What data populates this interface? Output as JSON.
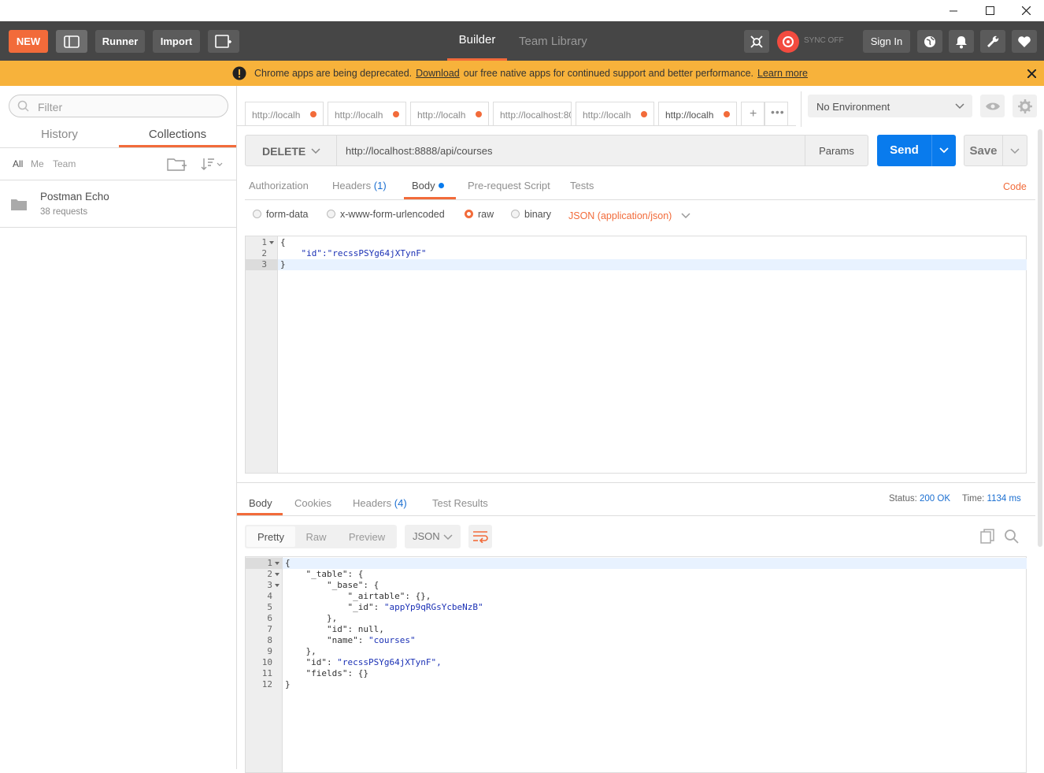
{
  "toolbar": {
    "new_label": "NEW",
    "runner_label": "Runner",
    "import_label": "Import",
    "builder_label": "Builder",
    "team_library_label": "Team Library",
    "sync_label": "SYNC OFF",
    "sign_in_label": "Sign In"
  },
  "banner": {
    "text_before": "Chrome apps are being deprecated.",
    "download_link": "Download",
    "text_after": "our free native apps for continued support and better performance.",
    "learn_more_link": "Learn more"
  },
  "sidebar": {
    "filter_placeholder": "Filter",
    "tab_history": "History",
    "tab_collections": "Collections",
    "filter_all": "All",
    "filter_me": "Me",
    "filter_team": "Team",
    "collections": [
      {
        "name": "Postman Echo",
        "count": "38 requests"
      }
    ]
  },
  "request_tabs": [
    "http://localh",
    "http://localh",
    "http://localh",
    "http://localhost:80",
    "http://localh",
    "http://localh"
  ],
  "environment": {
    "selected": "No Environment"
  },
  "request": {
    "method": "DELETE",
    "url": "http://localhost:8888/api/courses",
    "params_label": "Params",
    "send_label": "Send",
    "save_label": "Save"
  },
  "request_subtabs": {
    "authorization": "Authorization",
    "headers": "Headers",
    "headers_count": "(1)",
    "body": "Body",
    "pre_request": "Pre-request Script",
    "tests": "Tests",
    "code": "Code"
  },
  "body_modes": {
    "form_data": "form-data",
    "urlencoded": "x-www-form-urlencoded",
    "raw": "raw",
    "binary": "binary",
    "content_type": "JSON (application/json)"
  },
  "request_body_lines": [
    [
      "{",
      ""
    ],
    [
      "    ",
      "\"id\":\"recssPSYg64jXTynF\""
    ],
    [
      "}",
      ""
    ]
  ],
  "response_tabs": {
    "body": "Body",
    "cookies": "Cookies",
    "headers": "Headers",
    "headers_count": "(4)",
    "test_results": "Test Results"
  },
  "response_meta": {
    "status_label": "Status:",
    "status_value": "200 OK",
    "time_label": "Time:",
    "time_value": "1134 ms"
  },
  "response_view": {
    "pretty": "Pretty",
    "raw": "Raw",
    "preview": "Preview",
    "format": "JSON"
  },
  "response_body_lines": [
    [
      "{",
      ""
    ],
    [
      "    \"_table\": {",
      ""
    ],
    [
      "        \"_base\": {",
      ""
    ],
    [
      "            \"_airtable\": {},",
      ""
    ],
    [
      "            \"_id\": ",
      "\"appYp9qRGsYcbeNzB\""
    ],
    [
      "        },",
      ""
    ],
    [
      "        \"id\": null,",
      ""
    ],
    [
      "        \"name\": ",
      "\"courses\""
    ],
    [
      "    },",
      ""
    ],
    [
      "    \"id\": ",
      "\"recssPSYg64jXTynF\","
    ],
    [
      "    \"fields\": {}",
      ""
    ],
    [
      "}",
      ""
    ]
  ],
  "colors": {
    "accent": "#f26b3a",
    "send_blue": "#097bed",
    "toolbar_bg": "#464646",
    "banner_bg": "#f7b23b"
  }
}
